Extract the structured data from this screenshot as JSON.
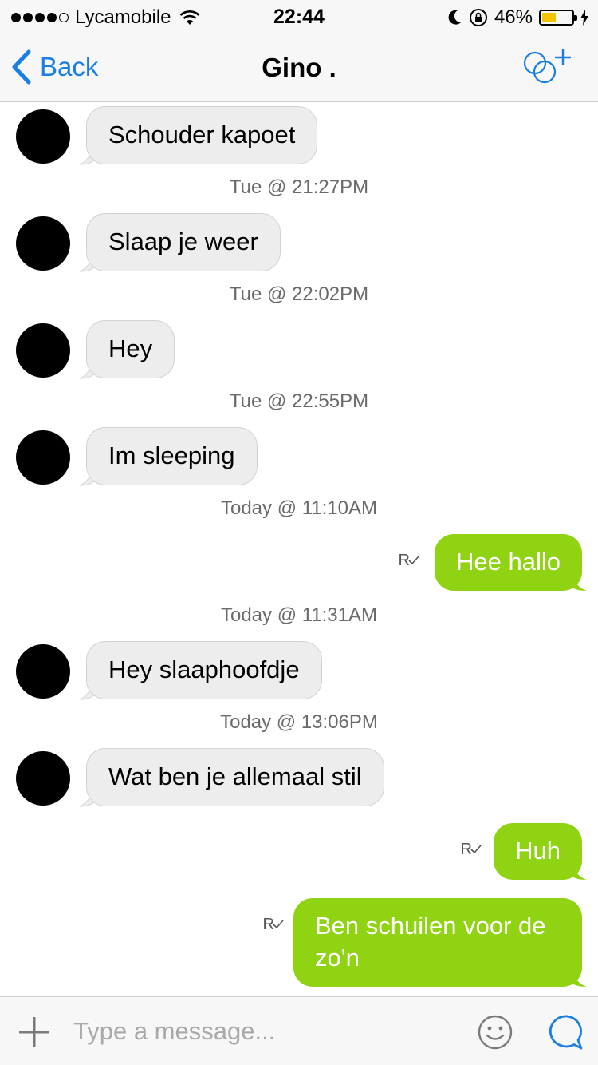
{
  "status_bar": {
    "carrier": "Lycamobile",
    "time": "22:44",
    "battery": "46%",
    "battery_level": 0.46
  },
  "nav": {
    "back_label": "Back",
    "title": "Gino ."
  },
  "messages": [
    {
      "dir": "in",
      "text": "Schouder kapoet"
    },
    {
      "dir": "stamp",
      "text": "Tue @ 21:27PM"
    },
    {
      "dir": "in",
      "text": "Slaap je weer"
    },
    {
      "dir": "stamp",
      "text": "Tue @ 22:02PM"
    },
    {
      "dir": "in",
      "text": "Hey"
    },
    {
      "dir": "stamp",
      "text": "Tue @ 22:55PM"
    },
    {
      "dir": "in",
      "text": "Im sleeping"
    },
    {
      "dir": "stamp",
      "text": "Today @ 11:10AM"
    },
    {
      "dir": "out",
      "text": "Hee hallo",
      "receipt": "R"
    },
    {
      "dir": "stamp",
      "text": "Today @ 11:31AM"
    },
    {
      "dir": "in",
      "text": "Hey slaaphoofdje"
    },
    {
      "dir": "stamp",
      "text": "Today @ 13:06PM"
    },
    {
      "dir": "in",
      "text": "Wat ben je allemaal stil"
    },
    {
      "dir": "out",
      "text": "Huh",
      "receipt": "R"
    },
    {
      "dir": "out",
      "text": "Ben schuilen voor de zo'n",
      "receipt": "R"
    }
  ],
  "composer": {
    "placeholder": "Type a message..."
  },
  "colors": {
    "accent": "#1a7ee3",
    "outgoing_bubble": "#8fd312",
    "incoming_bubble": "#ededed"
  }
}
